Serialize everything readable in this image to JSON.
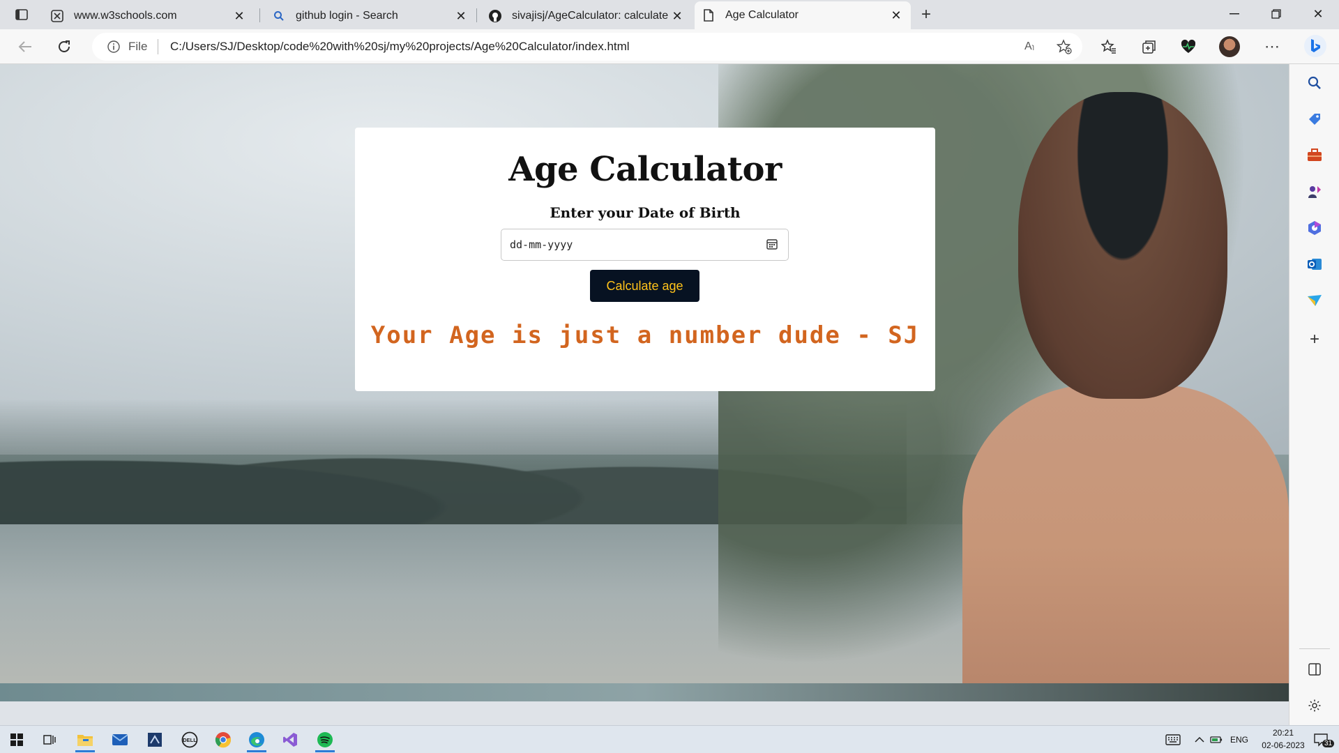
{
  "browser": {
    "tabs": [
      {
        "title": "www.w3schools.com",
        "active": false,
        "favicon": "w3schools-icon"
      },
      {
        "title": "github login - Search",
        "active": false,
        "favicon": "search-icon"
      },
      {
        "title": "sivajisj/AgeCalculator: calculate y",
        "active": false,
        "favicon": "github-icon"
      },
      {
        "title": "Age Calculator",
        "active": true,
        "favicon": "page-icon"
      }
    ],
    "address": {
      "scheme_label": "File",
      "url": "C:/Users/SJ/Desktop/code%20with%20sj/my%20projects/Age%20Calculator/index.html"
    }
  },
  "page": {
    "title": "Age Calculator",
    "dob_label": "Enter your Date of Birth",
    "date_placeholder": "dd-mm-yyyy",
    "button_label": "Calculate age",
    "result_text": "Your Age is just a number dude - SJ",
    "colors": {
      "button_bg": "#071222",
      "button_text": "#ffc21a",
      "result": "#d2651f"
    }
  },
  "taskbar": {
    "lang": "ENG",
    "time": "20:21",
    "date": "02-06-2023",
    "notification_count": "31"
  }
}
